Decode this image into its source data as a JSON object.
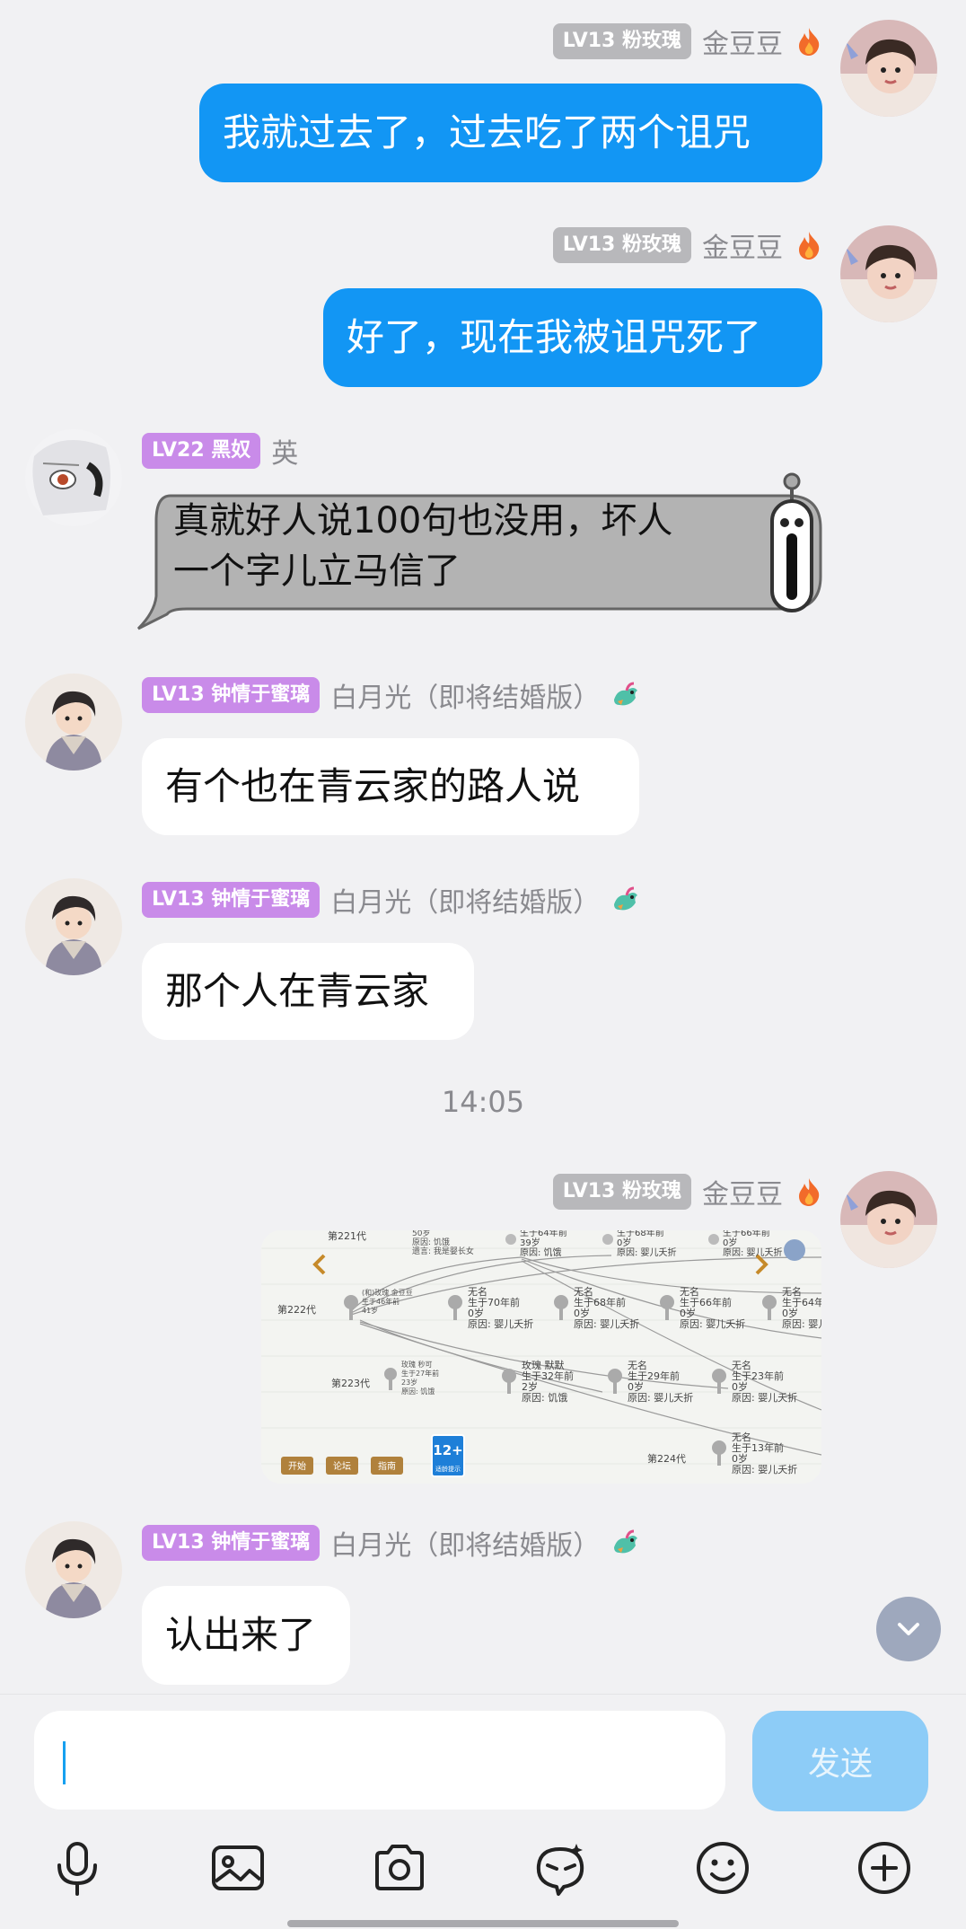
{
  "messages": [
    {
      "sender": "金豆豆",
      "level": "LV13 粉玫瑰",
      "text": "我就过去了，过去吃了两个诅咒",
      "side": "right"
    },
    {
      "sender": "金豆豆",
      "level": "LV13 粉玫瑰",
      "text": "好了，现在我被诅咒死了",
      "side": "right"
    },
    {
      "sender": "英",
      "level": "LV22 黑奴",
      "text_line1": "真就好人说100句也没用，坏人",
      "text_line2": "一个字儿立马信了",
      "side": "left"
    },
    {
      "sender": "白月光（即将结婚版）",
      "level": "LV13 钟情于蜜璃",
      "text": "有个也在青云家的路人说",
      "side": "left"
    },
    {
      "sender": "白月光（即将结婚版）",
      "level": "LV13 钟情于蜜璃",
      "text": "那个人在青云家",
      "side": "left"
    },
    {
      "sender": "金豆豆",
      "level": "LV13 粉玫瑰",
      "type": "image",
      "side": "right"
    },
    {
      "sender": "白月光（即将结婚版）",
      "level": "LV13 钟情于蜜璃",
      "text": "认出来了",
      "side": "left"
    }
  ],
  "timestamp": "14:05",
  "game_image": {
    "gen_labels": [
      "第221代",
      "第222代",
      "第223代",
      "第224代"
    ],
    "nodes": [
      {
        "l1": "50岁",
        "l2": "原因: 饥饿",
        "l3": "遗言: 我是婴长女"
      },
      {
        "l1": "生于64年前",
        "l2": "39岁",
        "l3": "原因: 饥饿"
      },
      {
        "l1": "生于68年前",
        "l2": "0岁",
        "l3": "原因: 婴儿夭折"
      },
      {
        "l1": "生于66年前",
        "l2": "0岁",
        "l3": "原因: 婴儿夭折"
      },
      {
        "l1": "(和)玫瑰 金豆豆",
        "l2": "生于46年前",
        "l3": "41岁"
      },
      {
        "l1": "无名",
        "l2": "生于70年前",
        "l3": "0岁",
        "l4": "原因: 婴儿夭折"
      },
      {
        "l1": "无名",
        "l2": "生于68年前",
        "l3": "0岁",
        "l4": "原因: 婴儿夭折"
      },
      {
        "l1": "无名",
        "l2": "生于66年前",
        "l3": "0岁",
        "l4": "原因: 婴儿夭折"
      },
      {
        "l1": "无名",
        "l2": "生于64年前",
        "l3": "0岁",
        "l4": "原因: 婴儿夭折"
      },
      {
        "l1": "玫瑰 秒可",
        "l2": "生于27年前",
        "l3": "23岁",
        "l4": "原因: 饥饿"
      },
      {
        "l1": "玫瑰 默默",
        "l2": "生于32年前",
        "l3": "2岁",
        "l4": "原因: 饥饿"
      },
      {
        "l1": "无名",
        "l2": "生于29年前",
        "l3": "0岁",
        "l4": "原因: 婴儿夭折"
      },
      {
        "l1": "无名",
        "l2": "生于23年前",
        "l3": "0岁",
        "l4": "原因: 婴儿夭折"
      },
      {
        "l1": "无名",
        "l2": "生于13年前",
        "l3": "0岁",
        "l4": "原因: 婴儿夭折"
      }
    ],
    "buttons": [
      "开始",
      "论坛",
      "指南"
    ],
    "age_badge": "12+",
    "age_caption": "适龄提示"
  },
  "input": {
    "value": ""
  },
  "send_label": "发送",
  "toolbar": [
    "microphone-icon",
    "image-icon",
    "camera-icon",
    "sticker-icon",
    "emoji-icon",
    "plus-icon"
  ],
  "colors": {
    "bubble_blue": "#1296f4",
    "badge_purple": "#c98be9",
    "badge_grey": "#b8b8bb",
    "send_button": "#8dccf7"
  }
}
